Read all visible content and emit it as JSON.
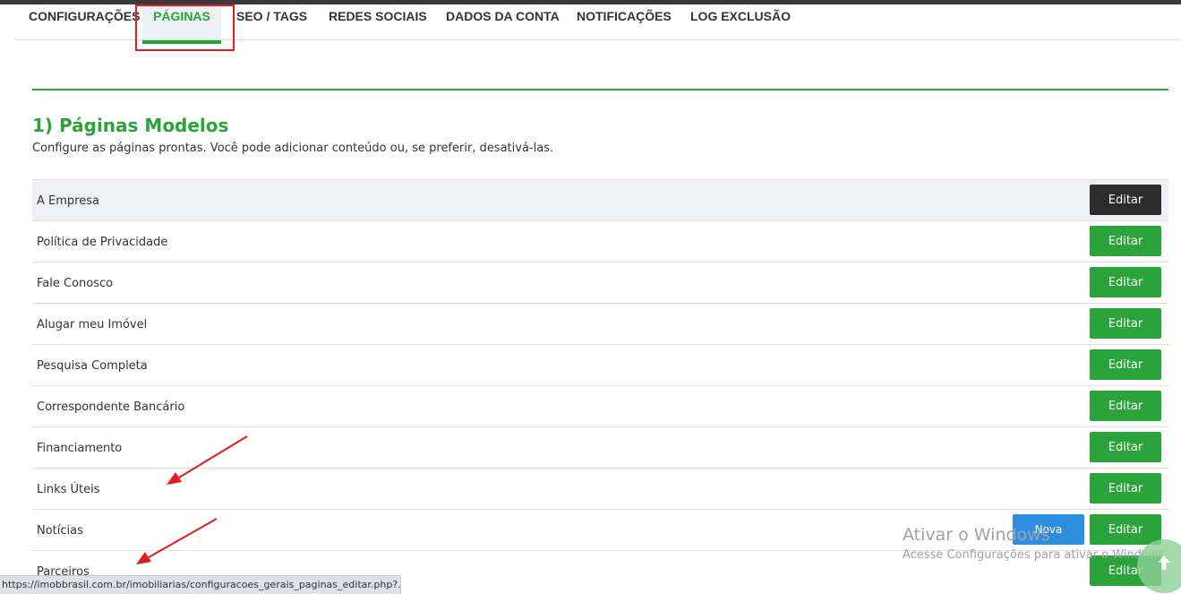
{
  "tabs": [
    {
      "label": "CONFIGURAÇÕES",
      "active": false
    },
    {
      "label": "PÁGINAS",
      "active": true
    },
    {
      "label": "SEO / TAGS",
      "active": false
    },
    {
      "label": "REDES SOCIAIS",
      "active": false
    },
    {
      "label": "DADOS DA CONTA",
      "active": false
    },
    {
      "label": "NOTIFICAÇÕES",
      "active": false
    },
    {
      "label": "LOG EXCLUSÃO",
      "active": false
    }
  ],
  "section": {
    "title": "1) Páginas Modelos",
    "description": "Configure as páginas prontas. Você pode adicionar conteúdo ou, se preferir, desativá-las."
  },
  "pages": [
    {
      "label": "A Empresa",
      "button": "Editar"
    },
    {
      "label": "Política de Privacidade",
      "button": "Editar"
    },
    {
      "label": "Fale Conosco",
      "button": "Editar"
    },
    {
      "label": "Alugar meu Imóvel",
      "button": "Editar"
    },
    {
      "label": "Pesquisa Completa",
      "button": "Editar"
    },
    {
      "label": "Correspondente Bancário",
      "button": "Editar"
    },
    {
      "label": "Financiamento",
      "button": "Editar"
    },
    {
      "label": "Links Úteis",
      "button": "Editar"
    },
    {
      "label": "Notícias",
      "button": "Editar"
    },
    {
      "label": "Parceiros",
      "button": "Editar"
    }
  ],
  "new_button": "Nova",
  "windows_activation": {
    "title": "Ativar o Windows",
    "subtitle": "Acesse Configurações para ativar o Windows."
  },
  "status_url": "https://imobbrasil.com.br/imobiliarias/configuracoes_gerais_paginas_editar.php?...",
  "colors": {
    "accent_green": "#2aa33a",
    "dark_button": "#2c2c2c",
    "blue_button": "#2e8fe0",
    "annotation_red": "#e01b22"
  },
  "icons": {
    "scroll_top": "arrow-up-icon"
  }
}
